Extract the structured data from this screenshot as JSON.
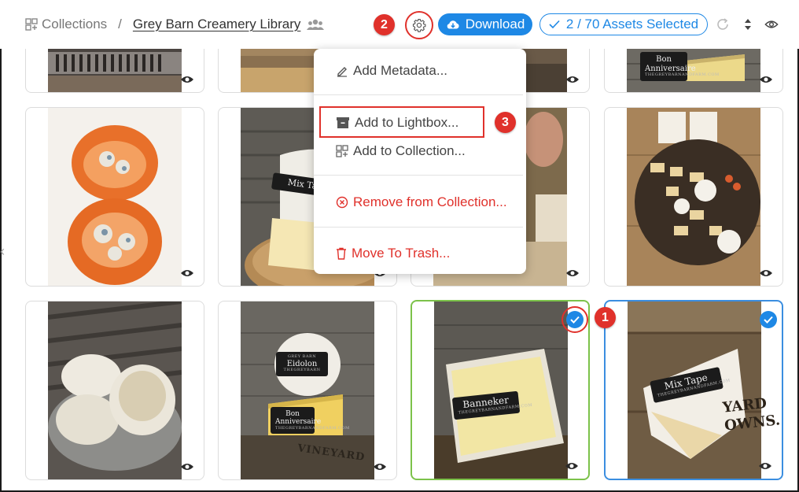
{
  "header": {
    "collections_label": "Collections",
    "separator": "/",
    "library_name": "Grey Barn Creamery Library",
    "download_label": "Download",
    "selection_label": "2 / 70 Assets Selected"
  },
  "badges": [
    "2",
    "3",
    "1"
  ],
  "menu": {
    "items": [
      {
        "label": "Add Metadata...",
        "icon": "pencil-icon"
      },
      {
        "label": "Add to Lightbox...",
        "icon": "archive-box-icon"
      },
      {
        "label": "Add to Collection...",
        "icon": "collection-grid-icon"
      },
      {
        "label": "Remove from Collection...",
        "icon": "circle-x-icon"
      },
      {
        "label": "Move To Trash...",
        "icon": "trash-icon"
      }
    ]
  },
  "photo_labels": {
    "bon_anniversaire_top": [
      "Bon",
      "Anniversaire",
      "THEGREYBARNANDFARM.COM"
    ],
    "mix_tape_mid": [
      "Mix Tap",
      ""
    ],
    "eidolon": [
      "GREY BARN",
      "Eidolon",
      "THEGREYBARN"
    ],
    "bon_anniversaire_bottom": [
      "Bon",
      "Anniversaire",
      "THEGREYBARNANDFARM.COM"
    ],
    "banneker": [
      "Banneker",
      "THEGREYBARNANDFARM.COM"
    ],
    "mix_tape_bottom": [
      "Mix Tape",
      "THEGREYBARNANDFARM.COM"
    ],
    "vineyard_crate": "VINEYARD",
    "yard_crate": [
      "YARD",
      "OWNS."
    ]
  },
  "colors": {
    "accent_blue": "#1e88e5",
    "annotation_red": "#e0312b",
    "selected_green": "#7cc24a"
  }
}
